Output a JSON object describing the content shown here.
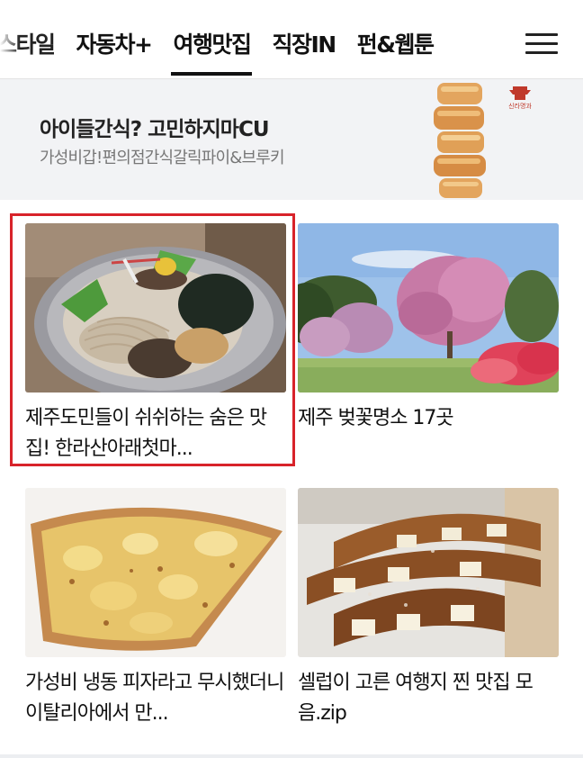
{
  "tabs": [
    {
      "label": "스타일",
      "name": "tab-style",
      "partial": true
    },
    {
      "label": "자동차+",
      "name": "tab-cars"
    },
    {
      "label": "여행맛집",
      "name": "tab-travel-food",
      "active": true
    },
    {
      "label": "직장IN",
      "name": "tab-work"
    },
    {
      "label": "펀&웹툰",
      "name": "tab-fun-webtoon"
    }
  ],
  "menu_icon": "hamburger-menu-icon",
  "ad": {
    "title": "아이들간식? 고민하지마CU",
    "description": "가성비갑!편의점간식갈릭파이&브루키",
    "logo_text": "신라명과"
  },
  "cards": [
    {
      "title": "제주도민들이 쉬쉬하는 숨은 맛집! 한라산아래첫마...",
      "image": "cold-buckwheat-noodles-image",
      "selected": true
    },
    {
      "title": "제주 벚꽃명소 17곳",
      "image": "cherry-blossom-park-image"
    },
    {
      "title": "가성비 냉동 피자라고 무시했더니 이탈리아에서 만...",
      "image": "pizza-slice-image"
    },
    {
      "title": "셀럽이 고른 여행지 찐 맛집 모음.zip",
      "image": "croissant-sandwiches-image"
    }
  ],
  "colors": {
    "highlight": "#d8232a",
    "tab_active": "#111111"
  }
}
